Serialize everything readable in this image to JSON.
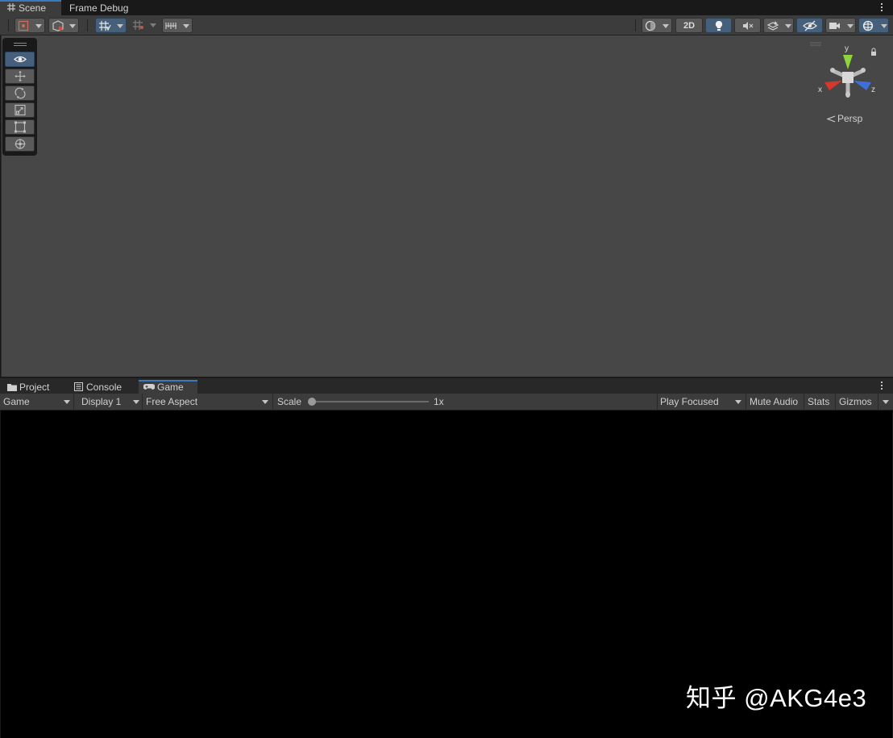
{
  "top_tabs": {
    "scene": {
      "label": "Scene",
      "icon": "grid-hash-icon"
    },
    "frame_debug": {
      "label": "Frame Debug"
    }
  },
  "scene_toolbar": {
    "two_d_label": "2D",
    "buttons": [
      "draw-mode-icon",
      "scene-camera-icon",
      "grid-snap-icon",
      "increment-snap-icon",
      "ruler-icon",
      "shading-mode-icon",
      "lighting-icon",
      "audio-mute-icon",
      "effects-icon",
      "visibility-icon",
      "camera-settings-icon",
      "gizmos-icon"
    ]
  },
  "tool_palette": {
    "tools": [
      "view-tool-icon",
      "move-tool-icon",
      "rotate-tool-icon",
      "scale-tool-icon",
      "rect-tool-icon",
      "transform-tool-icon"
    ],
    "active_tool": "view-tool-icon"
  },
  "scene_gizmo": {
    "x_label": "x",
    "y_label": "y",
    "z_label": "z",
    "projection_label": "Persp",
    "colors": {
      "x": "#d3382b",
      "y": "#8fd43c",
      "z": "#3e6fd9"
    }
  },
  "lower_tabs": {
    "project": {
      "label": "Project"
    },
    "console": {
      "label": "Console"
    },
    "game": {
      "label": "Game"
    }
  },
  "game_toolbar": {
    "view_select": "Game",
    "display_select": "Display 1",
    "aspect_select": "Free Aspect",
    "scale_label": "Scale",
    "scale_value_label": "1x",
    "scale_value": 1,
    "play_mode_select": "Play Focused",
    "mute_audio_label": "Mute Audio",
    "stats_label": "Stats",
    "gizmos_label": "Gizmos"
  },
  "watermark": "知乎 @AKG4e3",
  "colors": {
    "accent": "#3a79bb",
    "active_button": "#46607c",
    "scene_background": "#474747",
    "game_background": "#000000"
  }
}
